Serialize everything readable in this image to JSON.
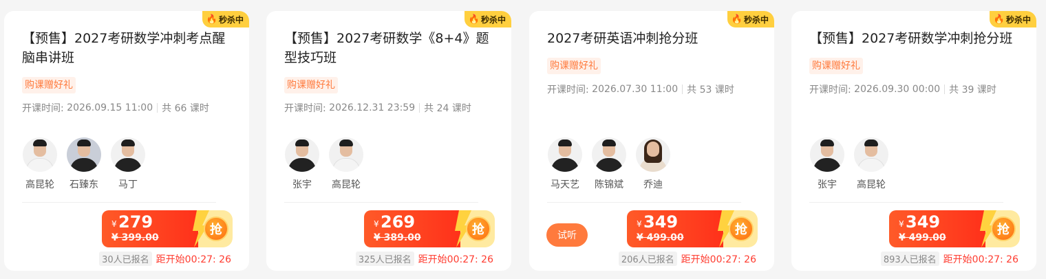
{
  "badge": {
    "icon": "flame-icon",
    "label": "秒杀中"
  },
  "colors": {
    "accent": "#ff3b2f",
    "tag": "#ff7a3d",
    "badge_bg": "#ffcf3f"
  },
  "cards": [
    {
      "title": "【预售】2027考研数学冲刺考点醒脑串讲班",
      "tag": "购课赠好礼",
      "time_label": "开课时间:",
      "time": "2026.09.15 11:00",
      "lessons": "共 66 课时",
      "teachers": [
        "高昆轮",
        "石臻东",
        "马丁"
      ],
      "currency": "¥",
      "price": "279",
      "original_price": "¥ 399.00",
      "grab": "抢",
      "enrolled": "30人已报名",
      "countdown": "距开始00:27: 26"
    },
    {
      "title": "【预售】2027考研数学《8+4》题型技巧班",
      "tag": "购课赠好礼",
      "time_label": "开课时间:",
      "time": "2026.12.31 23:59",
      "lessons": "共 24 课时",
      "teachers": [
        "张宇",
        "高昆轮"
      ],
      "currency": "¥",
      "price": "269",
      "original_price": "¥ 389.00",
      "grab": "抢",
      "enrolled": "325人已报名",
      "countdown": "距开始00:27: 26"
    },
    {
      "title": "2027考研英语冲刺抢分班",
      "tag": "购课赠好礼",
      "time_label": "开课时间:",
      "time": "2026.07.30 11:00",
      "lessons": "共 53 课时",
      "teachers": [
        "马天艺",
        "陈锦斌",
        "乔迪"
      ],
      "trial": "试听",
      "currency": "¥",
      "price": "349",
      "original_price": "¥ 499.00",
      "grab": "抢",
      "enrolled": "206人已报名",
      "countdown": "距开始00:27: 26"
    },
    {
      "title": "【预售】2027考研数学冲刺抢分班",
      "tag": "购课赠好礼",
      "time_label": "开课时间:",
      "time": "2026.09.30 00:00",
      "lessons": "共 39 课时",
      "teachers": [
        "张宇",
        "高昆轮"
      ],
      "currency": "¥",
      "price": "349",
      "original_price": "¥ 499.00",
      "grab": "抢",
      "enrolled": "893人已报名",
      "countdown": "距开始00:27: 26"
    }
  ]
}
